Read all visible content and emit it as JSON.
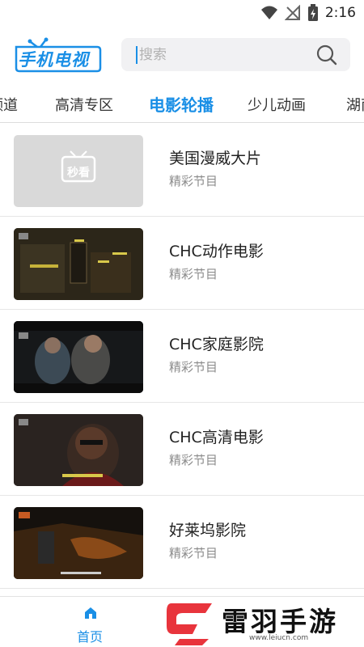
{
  "status_bar": {
    "time": "2:16"
  },
  "header": {
    "logo_text": "手机电视",
    "search_placeholder": "搜索"
  },
  "tabs": [
    {
      "label": "频道"
    },
    {
      "label": "高清专区"
    },
    {
      "label": "电影轮播",
      "active": true
    },
    {
      "label": "少儿动画"
    },
    {
      "label": "湖南"
    }
  ],
  "items": [
    {
      "title": "美国漫威大片",
      "subtitle": "精彩节目",
      "thumb_text": "秒看"
    },
    {
      "title": "CHC动作电影",
      "subtitle": "精彩节目"
    },
    {
      "title": "CHC家庭影院",
      "subtitle": "精彩节目"
    },
    {
      "title": "CHC高清电影",
      "subtitle": "精彩节目"
    },
    {
      "title": "好莱坞影院",
      "subtitle": "精彩节目"
    }
  ],
  "bottom_nav": {
    "home_label": "首页"
  },
  "watermark": {
    "text": "雷羽手游网",
    "url": "www.leiucn.com"
  },
  "colors": {
    "accent": "#1a8fe6",
    "watermark_red": "#e8343c"
  }
}
